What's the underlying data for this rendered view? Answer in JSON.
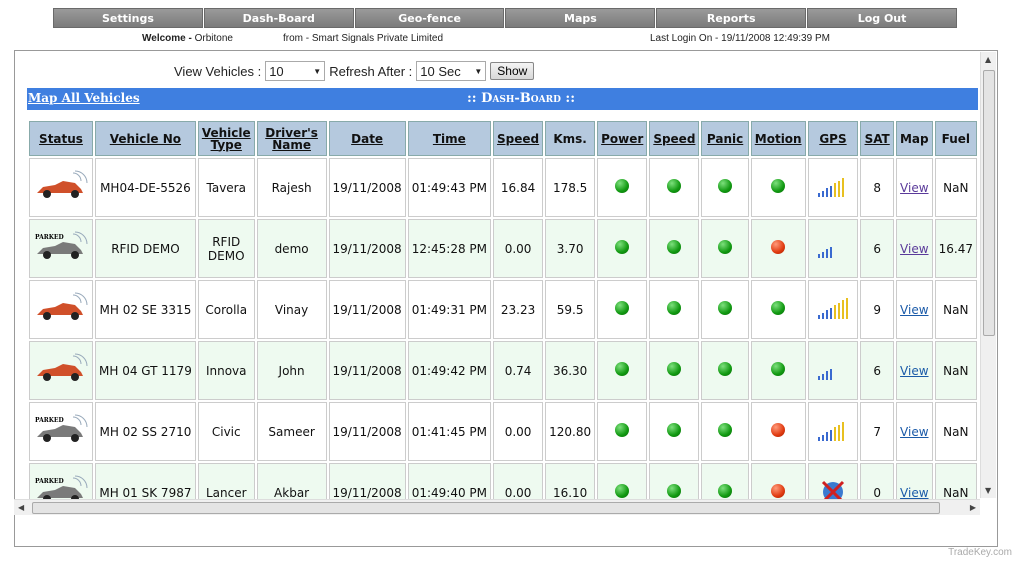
{
  "nav": {
    "items": [
      {
        "label": "Settings"
      },
      {
        "label": "Dash-Board"
      },
      {
        "label": "Geo-fence"
      },
      {
        "label": "Maps"
      },
      {
        "label": "Reports"
      },
      {
        "label": "Log Out"
      }
    ]
  },
  "welcome": {
    "label": "Welcome -",
    "user": "Orbitone",
    "from": "from - Smart Signals Private Limited",
    "last_login": "Last Login On - 19/11/2008 12:49:39 PM"
  },
  "controls": {
    "view_vehicles_label": "View Vehicles :",
    "view_vehicles_value": "10",
    "refresh_label": "Refresh After :",
    "refresh_value": "10 Sec",
    "show_label": "Show"
  },
  "dashboard": {
    "map_all_label": "Map All Vehicles",
    "title": ":: Dash-Board ::"
  },
  "table": {
    "headers": [
      "Status",
      "Vehicle No",
      "Vehicle Type",
      "Driver's Name",
      "Date",
      "Time",
      "Speed",
      "Kms.",
      "Power",
      "Speed",
      "Panic",
      "Motion",
      "GPS",
      "SAT",
      "Map",
      "Fuel"
    ],
    "rows": [
      {
        "status": "moving",
        "vehicle_no": "MH04-DE-5526",
        "type": "Tavera",
        "driver": "Rajesh",
        "date": "19/11/2008",
        "time": "01:49:43 PM",
        "speed": "16.84",
        "kms": "178.5",
        "power": "green",
        "speed_ind": "green",
        "panic": "green",
        "motion": "green",
        "gps_bars": 7,
        "sat": "8",
        "map": "View",
        "fuel": "NaN"
      },
      {
        "status": "parked",
        "vehicle_no": "RFID DEMO",
        "type": "RFID DEMO",
        "driver": "demo",
        "date": "19/11/2008",
        "time": "12:45:28 PM",
        "speed": "0.00",
        "kms": "3.70",
        "power": "green",
        "speed_ind": "green",
        "panic": "green",
        "motion": "red",
        "gps_bars": 4,
        "sat": "6",
        "map": "View",
        "fuel": "16.47"
      },
      {
        "status": "moving",
        "vehicle_no": "MH 02 SE 3315",
        "type": "Corolla",
        "driver": "Vinay",
        "date": "19/11/2008",
        "time": "01:49:31 PM",
        "speed": "23.23",
        "kms": "59.5",
        "power": "green",
        "speed_ind": "green",
        "panic": "green",
        "motion": "green",
        "gps_bars": 8,
        "sat": "9",
        "map": "View",
        "fuel": "NaN"
      },
      {
        "status": "moving",
        "vehicle_no": "MH 04 GT 1179",
        "type": "Innova",
        "driver": "John",
        "date": "19/11/2008",
        "time": "01:49:42 PM",
        "speed": "0.74",
        "kms": "36.30",
        "power": "green",
        "speed_ind": "green",
        "panic": "green",
        "motion": "green",
        "gps_bars": 4,
        "sat": "6",
        "map": "View",
        "fuel": "NaN"
      },
      {
        "status": "parked",
        "vehicle_no": "MH 02 SS 2710",
        "type": "Civic",
        "driver": "Sameer",
        "date": "19/11/2008",
        "time": "01:41:45 PM",
        "speed": "0.00",
        "kms": "120.80",
        "power": "green",
        "speed_ind": "green",
        "panic": "green",
        "motion": "red",
        "gps_bars": 7,
        "sat": "7",
        "map": "View",
        "fuel": "NaN"
      },
      {
        "status": "parked",
        "vehicle_no": "MH 01 SK 7987",
        "type": "Lancer",
        "driver": "Akbar",
        "date": "19/11/2008",
        "time": "01:49:40 PM",
        "speed": "0.00",
        "kms": "16.10",
        "power": "green",
        "speed_ind": "green",
        "panic": "green",
        "motion": "red",
        "gps_bars": 0,
        "sat": "0",
        "map": "View",
        "fuel": "NaN"
      }
    ]
  },
  "parked_label": "PARKED",
  "watermark": "TradeKey.com"
}
